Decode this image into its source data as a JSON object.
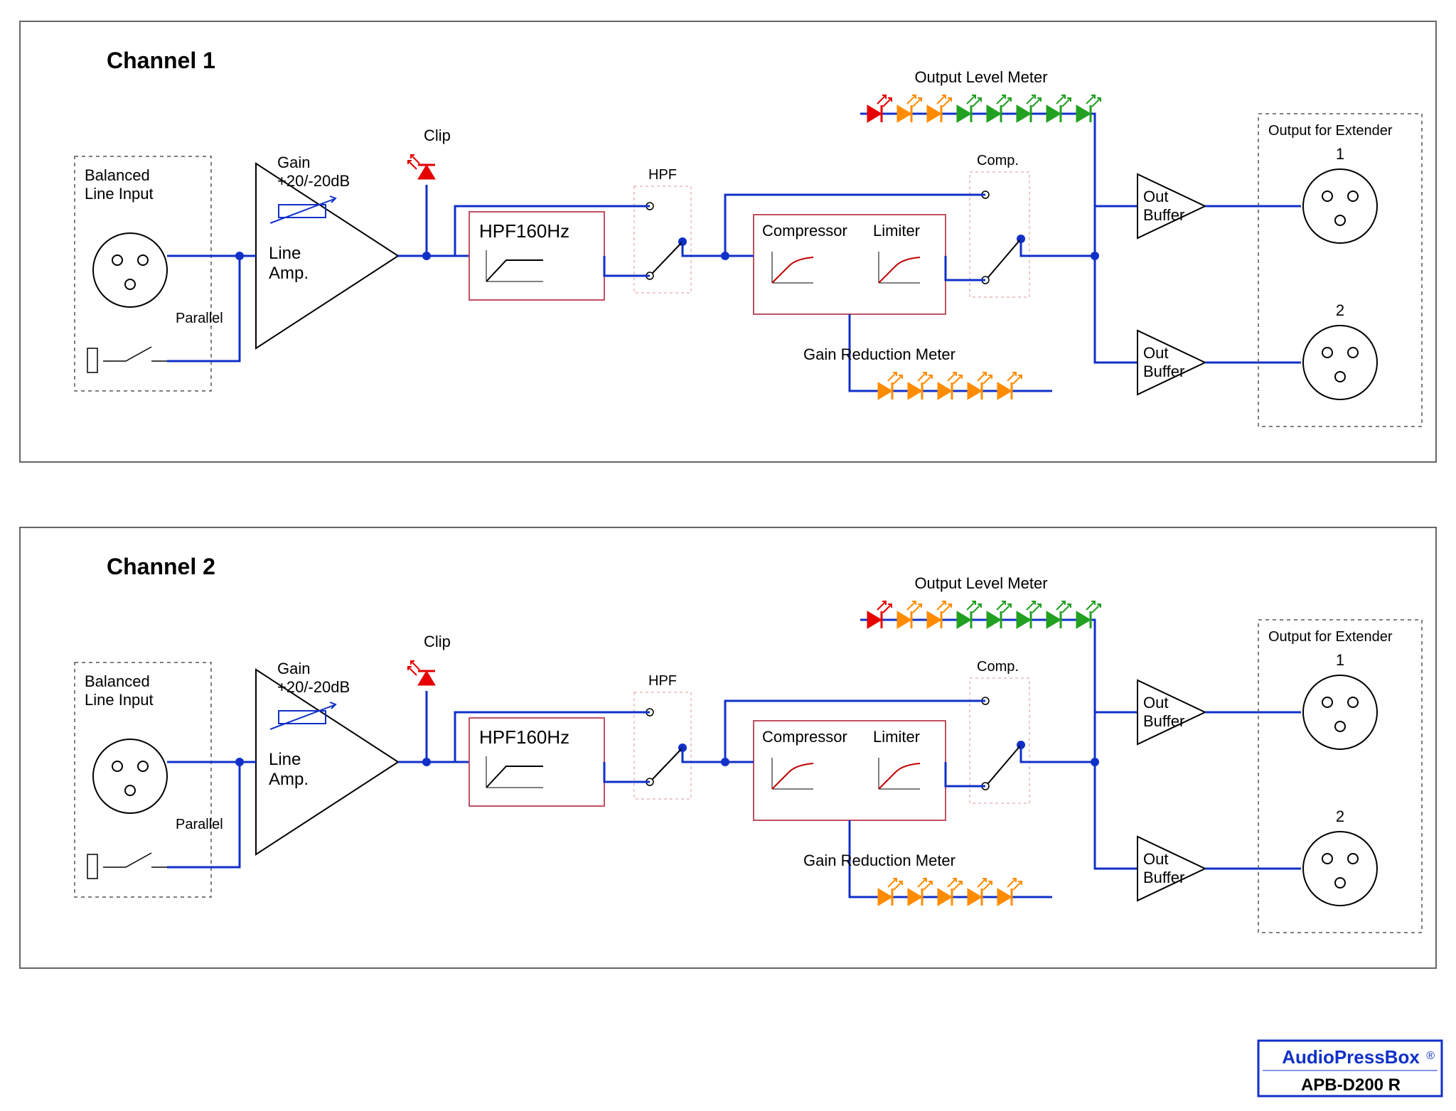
{
  "channels": [
    {
      "title": "Channel 1"
    },
    {
      "title": "Channel 2"
    }
  ],
  "labels": {
    "balanced_input": "Balanced\nLine Input",
    "parallel": "Parallel",
    "gain": "Gain\n+20/-20dB",
    "clip": "Clip",
    "line_amp": "Line\nAmp.",
    "hpf_block": "HPF160Hz",
    "hpf_switch": "HPF",
    "compressor": "Compressor",
    "limiter": "Limiter",
    "comp_switch": "Comp.",
    "gain_red_meter": "Gain Reduction Meter",
    "out_level_meter": "Output Level Meter",
    "out_buffer": "Out\nBuffer",
    "output_ext": "Output for Extender",
    "out1": "1",
    "out2": "2"
  },
  "footer": {
    "brand": "AudioPressBox",
    "model": "APB-D200 R"
  },
  "meter_colors": {
    "output_level": [
      "#e60000",
      "#ff8c00",
      "#ff8c00",
      "#22a022",
      "#22a022",
      "#22a022",
      "#22a022",
      "#22a022"
    ],
    "gain_reduction": [
      "#ff8c00",
      "#ff8c00",
      "#ff8c00",
      "#ff8c00",
      "#ff8c00"
    ]
  },
  "chart_data": {
    "type": "block-signal-flow",
    "device": "APB-D200 R",
    "channels": 2,
    "signal_chain_per_channel": [
      "Balanced Line Input (XLR) with Parallel link switch",
      "Line Amp (Gain +20/-20 dB) with Clip LED",
      "HPF 160 Hz (switchable)",
      "Compressor + Limiter (switchable, with Gain Reduction Meter 5-LED)",
      "Output Level Meter (8-LED)",
      "2 × Out Buffer",
      "Output for Extender: XLR 1 and XLR 2"
    ],
    "gain_range_dB": [
      -20,
      20
    ],
    "hpf_corner_hz": 160,
    "output_level_meter_leds": 8,
    "gain_reduction_meter_leds": 5
  }
}
